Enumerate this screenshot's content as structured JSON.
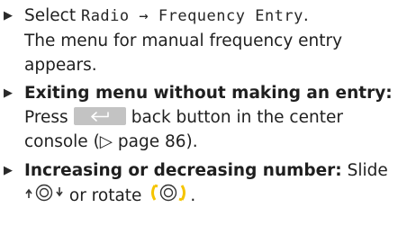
{
  "steps": [
    {
      "lines": [
        {
          "prefix": "Select ",
          "menu1": "Radio",
          "sep": " → ",
          "menu2": "Frequency Entry",
          "suffix": "."
        },
        "The menu for manual frequency entry",
        "appears."
      ]
    },
    {
      "title": "Exiting menu without making an entry:",
      "line2_pre": "Press",
      "line2_post": "back button in the center",
      "line3": "console (▷ page 86)."
    },
    {
      "title": "Increasing or decreasing number:",
      "line1_post": " Slide",
      "line2_mid": " or rotate ",
      "line2_end": "."
    }
  ],
  "icons": {
    "bullet": "triangle-right-icon",
    "back_button": "back-arrow-icon",
    "controller_slide": "controller-slide-up-down-icon",
    "controller_rotate": "controller-rotate-icon"
  },
  "colors": {
    "text": "#1f1f1f",
    "back_button_bg": "#c3c3c3",
    "rotate_bracket": "#f5c400"
  }
}
